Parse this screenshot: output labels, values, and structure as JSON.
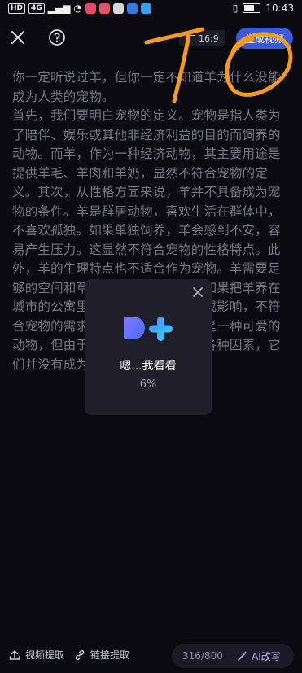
{
  "status_bar": {
    "left_badges": [
      "HD",
      "4G"
    ],
    "time": "10:43"
  },
  "toolbar": {
    "aspect_ratio": "16:9",
    "generate_label": "生成视频"
  },
  "article": {
    "paragraphs": [
      "你一定听说过羊，但你一定不知道羊为什么没能成为人类的宠物。",
      "首先，我们要明白宠物的定义。宠物是指人类为了陪伴、娱乐或其他非经济利益的目的而饲养的动物。而羊，作为一种经济动物，其主要用途是提供羊毛、羊肉和羊奶，显然不符合宠物的定义。其次，从性格方面来说，羊并不具备成为宠物的条件。羊是群居动物，喜欢生活在群体中，不喜欢孤独。如果单独饲养，羊会感到不安，容易产生压力。这显然不符合宠物的性格特点。此外，羊的生理特点也不适合作为宠物。羊需要足够的空间和草料，才能保持健康。如果把羊养在城市的公寓里，会对它们的健康造成影响，不符合宠物的需求不符。总之，虽然羊是一种可爱的动物，但由于其不适合作为宠物的各种因素，它们并没有成为人类的宠物。"
    ]
  },
  "overlay": {
    "scribble_text": "10"
  },
  "dialog": {
    "message": "嗯...我看看",
    "progress_percent": "6%"
  },
  "bottom_bar": {
    "video_extract_label": "视频提取",
    "link_extract_label": "链接提取",
    "char_count": "316/800",
    "ai_rewrite_label": "AI改写"
  },
  "colors": {
    "background": "#0b0a10",
    "scribble": "#f39a1f",
    "accent": "#3a5bd8",
    "dialog": "#1f1e29"
  }
}
